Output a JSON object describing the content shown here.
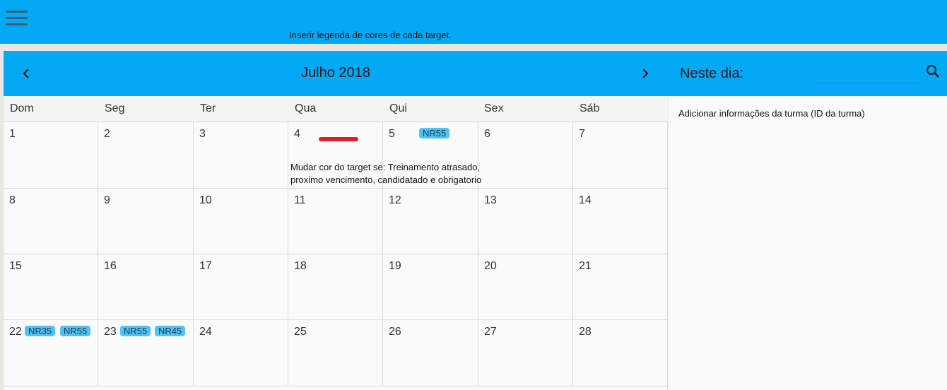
{
  "topbar": {
    "menu_icon": "hamburger-menu-icon",
    "legend_note": "Inserir legenda de cores de cada target.",
    "color": "#03a9f4"
  },
  "calendar": {
    "title": "Julho 2018",
    "prev_icon": "chevron-left-icon",
    "next_icon": "chevron-right-icon",
    "weekdays": [
      "Dom",
      "Seg",
      "Ter",
      "Qua",
      "Qui",
      "Sex",
      "Sáb"
    ],
    "weeks": [
      [
        {
          "day": "1",
          "tags": []
        },
        {
          "day": "2",
          "tags": []
        },
        {
          "day": "3",
          "tags": []
        },
        {
          "day": "4",
          "tags": []
        },
        {
          "day": "5",
          "tags": [
            "NR55"
          ]
        },
        {
          "day": "6",
          "tags": []
        },
        {
          "day": "7",
          "tags": []
        }
      ],
      [
        {
          "day": "8",
          "tags": []
        },
        {
          "day": "9",
          "tags": []
        },
        {
          "day": "10",
          "tags": []
        },
        {
          "day": "11",
          "tags": []
        },
        {
          "day": "12",
          "tags": []
        },
        {
          "day": "13",
          "tags": []
        },
        {
          "day": "14",
          "tags": []
        }
      ],
      [
        {
          "day": "15",
          "tags": []
        },
        {
          "day": "16",
          "tags": []
        },
        {
          "day": "17",
          "tags": []
        },
        {
          "day": "18",
          "tags": []
        },
        {
          "day": "19",
          "tags": []
        },
        {
          "day": "20",
          "tags": []
        },
        {
          "day": "21",
          "tags": []
        }
      ],
      [
        {
          "day": "22",
          "tags": [
            "NR35",
            "NR55"
          ]
        },
        {
          "day": "23",
          "tags": [
            "NR55",
            "NR45"
          ]
        },
        {
          "day": "24",
          "tags": []
        },
        {
          "day": "25",
          "tags": []
        },
        {
          "day": "26",
          "tags": []
        },
        {
          "day": "27",
          "tags": []
        },
        {
          "day": "28",
          "tags": []
        }
      ]
    ],
    "annotation": {
      "line1": "Mudar cor do target se: Treinamento atrasado,",
      "line2": "proximo vencimento, candidatado e obrigatorio"
    },
    "tag_color": "#4fc3f7",
    "mark_color": "#e21d24"
  },
  "sidebar": {
    "title": "Neste dia:",
    "search_placeholder": "",
    "search_icon": "search-icon",
    "info": "Adicionar informações da turma (ID da turma)"
  }
}
